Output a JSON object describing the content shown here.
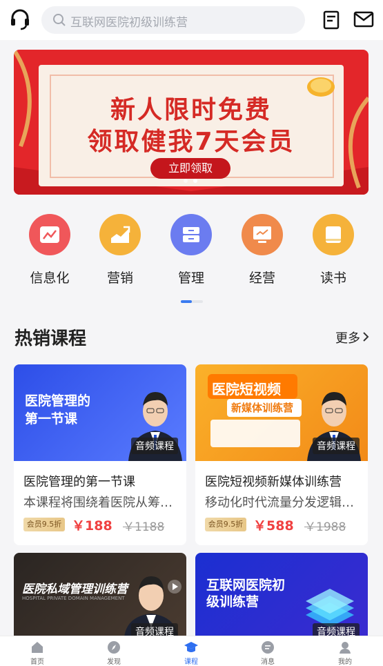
{
  "search": {
    "placeholder": "互联网医院初级训练营"
  },
  "banner": {
    "line1": "新人限时免费",
    "line2": "领取健我7天会员",
    "button": "立即领取",
    "slide_count": 2,
    "active_slide": 2
  },
  "categories": [
    {
      "label": "信息化",
      "icon": "chart-line-icon",
      "color": "#f0575a"
    },
    {
      "label": "营销",
      "icon": "trend-chart-icon",
      "color": "#f5b23a"
    },
    {
      "label": "管理",
      "icon": "cabinet-icon",
      "color": "#6b7cf0"
    },
    {
      "label": "经营",
      "icon": "monitor-icon",
      "color": "#f08a4b"
    },
    {
      "label": "读书",
      "icon": "book-icon",
      "color": "#f5b23a"
    }
  ],
  "section": {
    "title": "热销课程",
    "more": "更多"
  },
  "courses": [
    {
      "thumb_title1": "医院管理的",
      "thumb_title2": "第一节课",
      "tag": "音频课程",
      "title": "医院管理的第一节课",
      "desc": "本课程将围绕着医院从筹备到运营的全过程",
      "vip": "会员9.5折",
      "price": "￥188",
      "orig": "￥1188"
    },
    {
      "thumb_title1": "医院短视频",
      "thumb_title2": "新媒体训练营",
      "tag": "音频课程",
      "title": "医院短视频新媒体训练营",
      "desc": "移动化时代流量分发逻辑的变化",
      "vip": "会员9.5折",
      "price": "￥588",
      "orig": "￥1988"
    },
    {
      "thumb_title1": "医院私域管理训练营",
      "thumb_sub": "HOSPITAL PRIVATE DOMAIN MANAGEMENT",
      "tag": "音频课程"
    },
    {
      "thumb_title1": "互联网医院初",
      "thumb_title2": "级训练营",
      "tag": "音频课程"
    }
  ],
  "tabs": [
    {
      "label": "首页",
      "icon": "home-icon"
    },
    {
      "label": "发现",
      "icon": "compass-icon"
    },
    {
      "label": "课程",
      "icon": "graduation-cap-icon",
      "active": true
    },
    {
      "label": "消息",
      "icon": "message-icon"
    },
    {
      "label": "我的",
      "icon": "profile-icon"
    }
  ],
  "colors": {
    "accent": "#2f6ff0",
    "price": "#f04040",
    "banner_red": "#e3262a"
  }
}
